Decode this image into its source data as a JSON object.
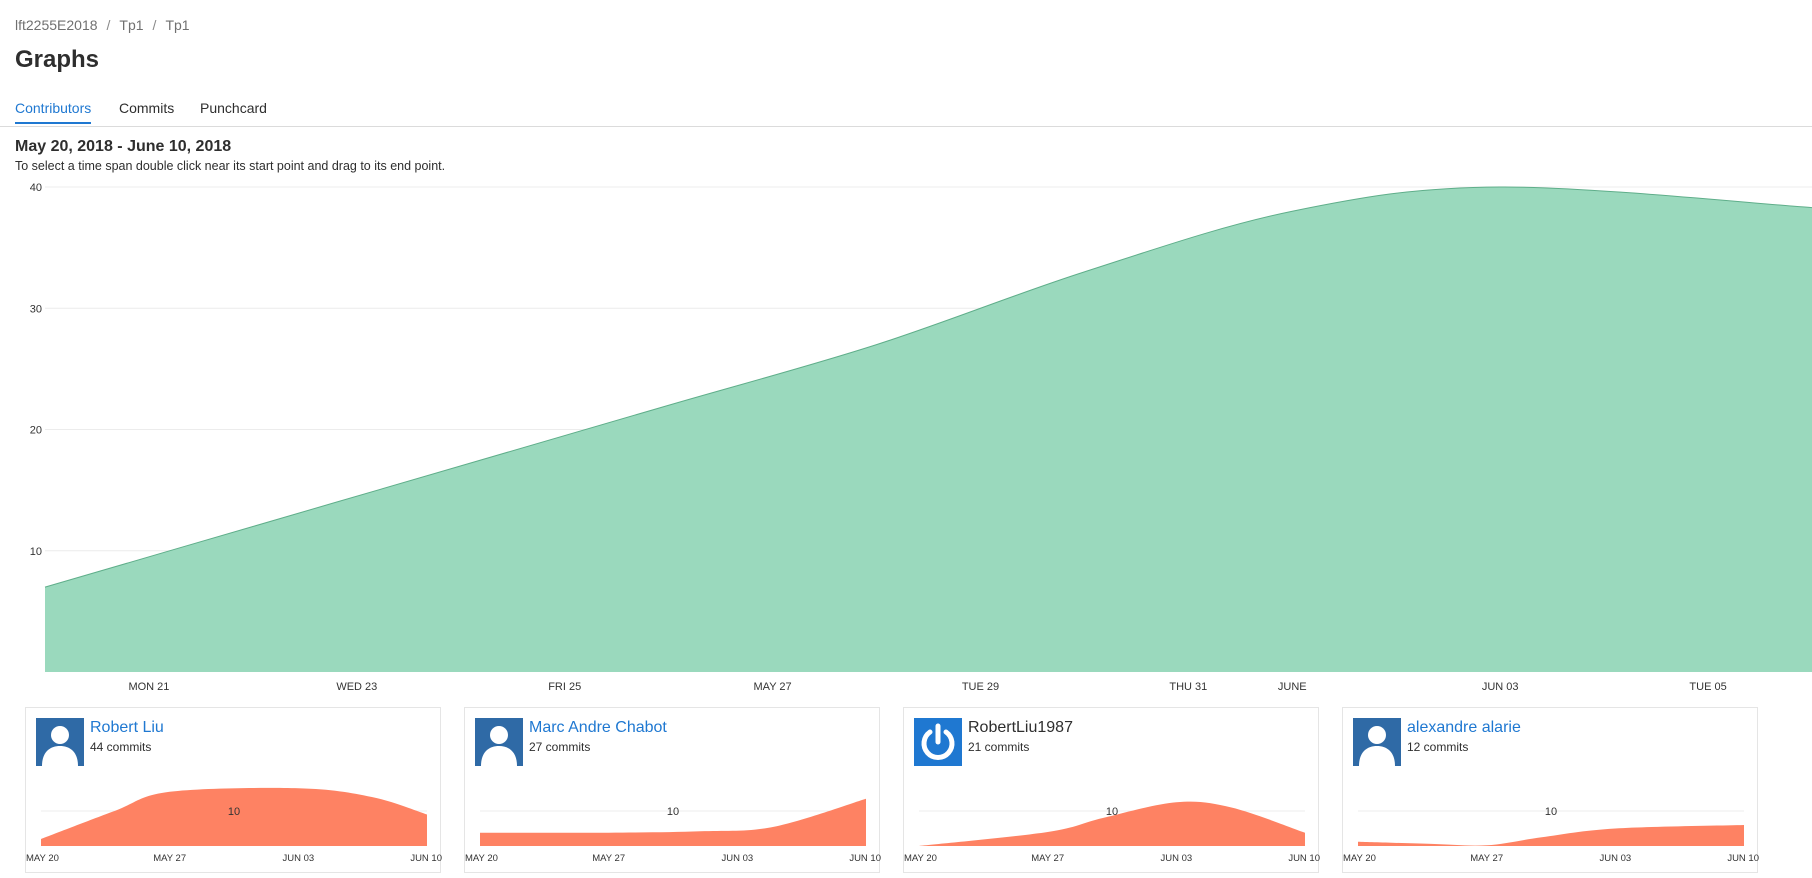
{
  "breadcrumb": [
    "lft2255E2018",
    "Tp1",
    "Tp1"
  ],
  "page_title": "Graphs",
  "tabs": [
    {
      "label": "Contributors",
      "active": true
    },
    {
      "label": "Commits",
      "active": false
    },
    {
      "label": "Punchcard",
      "active": false
    }
  ],
  "date_range": "May 20, 2018 - June 10, 2018",
  "hint": "To select a time span double click near its start point and drag to its end point.",
  "colors": {
    "main_fill": "#9ad9bd",
    "main_stroke": "#5fae8a",
    "mini_fill": "#fe8263",
    "link": "#1f78d1",
    "avatar": "#2f6aa6"
  },
  "chart_data": [
    {
      "type": "area",
      "title": "",
      "xlabel": "",
      "ylabel": "",
      "x_range": [
        "2018-05-20",
        "2018-06-06"
      ],
      "ylim": [
        0,
        40
      ],
      "y_ticks": [
        10,
        20,
        30,
        40
      ],
      "x_tick_labels": [
        {
          "date": "2018-05-21",
          "label": "MON 21"
        },
        {
          "date": "2018-05-23",
          "label": "WED 23"
        },
        {
          "date": "2018-05-25",
          "label": "FRI 25"
        },
        {
          "date": "2018-05-27",
          "label": "MAY 27"
        },
        {
          "date": "2018-05-29",
          "label": "TUE 29"
        },
        {
          "date": "2018-05-31",
          "label": "THU 31"
        },
        {
          "date": "2018-06-01",
          "label": "JUNE"
        },
        {
          "date": "2018-06-03",
          "label": "JUN 03"
        },
        {
          "date": "2018-06-05",
          "label": "TUE 05"
        }
      ],
      "grid": true,
      "series": [
        {
          "points": [
            {
              "x": "2018-05-20",
              "y": 7
            },
            {
              "x": "2018-05-22",
              "y": 12
            },
            {
              "x": "2018-05-24",
              "y": 17
            },
            {
              "x": "2018-05-26",
              "y": 22
            },
            {
              "x": "2018-05-28",
              "y": 27
            },
            {
              "x": "2018-05-30",
              "y": 33
            },
            {
              "x": "2018-06-01",
              "y": 38
            },
            {
              "x": "2018-06-03",
              "y": 40
            },
            {
              "x": "2018-06-06",
              "y": 38.3
            }
          ]
        }
      ]
    }
  ],
  "contributors": [
    {
      "name": "Robert Liu",
      "commits": "44 commits",
      "avatar": "person-icon",
      "linked": true,
      "chart_data": {
        "type": "area",
        "ylim": [
          0,
          16
        ],
        "y_ticks": [
          10
        ],
        "x_range": [
          "2018-05-20",
          "2018-06-10"
        ],
        "x_tick_labels": [
          {
            "date": "2018-05-20",
            "label": "MAY 20"
          },
          {
            "date": "2018-05-27",
            "label": "MAY 27"
          },
          {
            "date": "2018-06-03",
            "label": "JUN 03"
          },
          {
            "date": "2018-06-10",
            "label": "JUN 10"
          }
        ],
        "points": [
          {
            "x": "2018-05-20",
            "y": 2
          },
          {
            "x": "2018-05-24",
            "y": 10
          },
          {
            "x": "2018-05-27",
            "y": 15.5
          },
          {
            "x": "2018-06-03",
            "y": 16.5
          },
          {
            "x": "2018-06-07",
            "y": 14
          },
          {
            "x": "2018-06-10",
            "y": 9
          }
        ]
      }
    },
    {
      "name": "Marc Andre Chabot",
      "commits": "27 commits",
      "avatar": "person-icon",
      "linked": true,
      "chart_data": {
        "type": "area",
        "ylim": [
          0,
          16
        ],
        "y_ticks": [
          10
        ],
        "x_range": [
          "2018-05-20",
          "2018-06-10"
        ],
        "x_tick_labels": [
          {
            "date": "2018-05-20",
            "label": "MAY 20"
          },
          {
            "date": "2018-05-27",
            "label": "MAY 27"
          },
          {
            "date": "2018-06-03",
            "label": "JUN 03"
          },
          {
            "date": "2018-06-10",
            "label": "JUN 10"
          }
        ],
        "points": [
          {
            "x": "2018-05-20",
            "y": 3.8
          },
          {
            "x": "2018-05-27",
            "y": 3.8
          },
          {
            "x": "2018-06-01",
            "y": 4.2
          },
          {
            "x": "2018-06-05",
            "y": 5.5
          },
          {
            "x": "2018-06-10",
            "y": 13.5
          }
        ]
      }
    },
    {
      "name": "RobertLiu1987",
      "commits": "21 commits",
      "avatar": "power-icon",
      "linked": false,
      "chart_data": {
        "type": "area",
        "ylim": [
          0,
          16
        ],
        "y_ticks": [
          10
        ],
        "x_range": [
          "2018-05-20",
          "2018-06-10"
        ],
        "x_tick_labels": [
          {
            "date": "2018-05-20",
            "label": "MAY 20"
          },
          {
            "date": "2018-05-27",
            "label": "MAY 27"
          },
          {
            "date": "2018-06-03",
            "label": "JUN 03"
          },
          {
            "date": "2018-06-10",
            "label": "JUN 10"
          }
        ],
        "points": [
          {
            "x": "2018-05-20",
            "y": 0
          },
          {
            "x": "2018-05-27",
            "y": 4
          },
          {
            "x": "2018-05-30",
            "y": 8
          },
          {
            "x": "2018-06-03",
            "y": 12.5
          },
          {
            "x": "2018-06-06",
            "y": 11
          },
          {
            "x": "2018-06-10",
            "y": 3.8
          }
        ]
      }
    },
    {
      "name": "alexandre alarie",
      "commits": "12 commits",
      "avatar": "person-icon",
      "linked": true,
      "chart_data": {
        "type": "area",
        "ylim": [
          0,
          16
        ],
        "y_ticks": [
          10
        ],
        "x_range": [
          "2018-05-20",
          "2018-06-10"
        ],
        "x_tick_labels": [
          {
            "date": "2018-05-20",
            "label": "MAY 20"
          },
          {
            "date": "2018-05-27",
            "label": "MAY 27"
          },
          {
            "date": "2018-06-03",
            "label": "JUN 03"
          },
          {
            "date": "2018-06-10",
            "label": "JUN 10"
          }
        ],
        "points": [
          {
            "x": "2018-05-20",
            "y": 1.2
          },
          {
            "x": "2018-05-24",
            "y": 0.6
          },
          {
            "x": "2018-05-27",
            "y": 0.2
          },
          {
            "x": "2018-05-30",
            "y": 2.5
          },
          {
            "x": "2018-06-03",
            "y": 5
          },
          {
            "x": "2018-06-10",
            "y": 6
          }
        ]
      }
    }
  ]
}
